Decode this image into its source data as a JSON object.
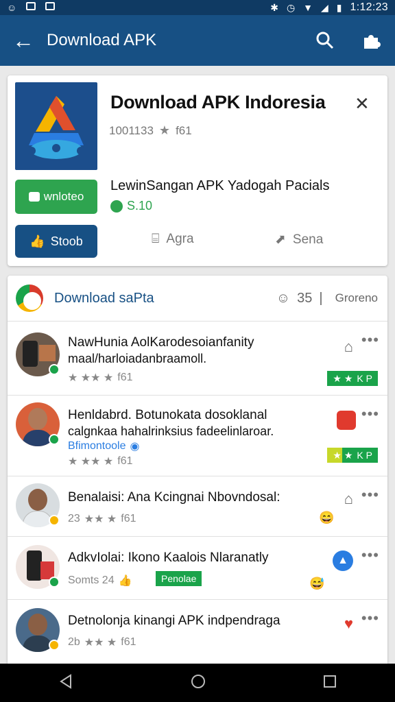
{
  "status": {
    "time": "1:12:23"
  },
  "appbar": {
    "title": "Download APK"
  },
  "app": {
    "title": "Download APK Indoresia",
    "count": "1001133",
    "rating_text": "f61",
    "download_label": "wnloteo",
    "description": "LewinSangan APK Yadogah Pacials",
    "price": "S.10",
    "like_label": "Stoob",
    "agree_label": "Agra",
    "send_label": "Sena"
  },
  "section": {
    "title": "Download saPta",
    "count": "35",
    "sort_label": "Groreno"
  },
  "items": [
    {
      "title": "NawHunia AolKarodesoianfanity",
      "subtitle": "maal/harloiadanbraamoll.",
      "meta": "f61",
      "tag": "K P"
    },
    {
      "title": "Henldabrd. Botunokata dosoklanal",
      "subtitle": "calgnkaa hahalrinksius fadeelinlaroar.",
      "link": "Bfimontoole",
      "meta": "f61",
      "tag": "K P"
    },
    {
      "title": "Benalaisi: Ana Kcingnai Nbovndosal:",
      "meta_prefix": "23",
      "meta": "f61"
    },
    {
      "title": "AdkvIolai: Ikono Kaalois Nlaranatly",
      "meta": "Somts 24",
      "tag": "Penolae"
    },
    {
      "title": "Detnolonja kinangi APK indpendraga",
      "meta_prefix": "2b",
      "meta": "f61"
    }
  ]
}
